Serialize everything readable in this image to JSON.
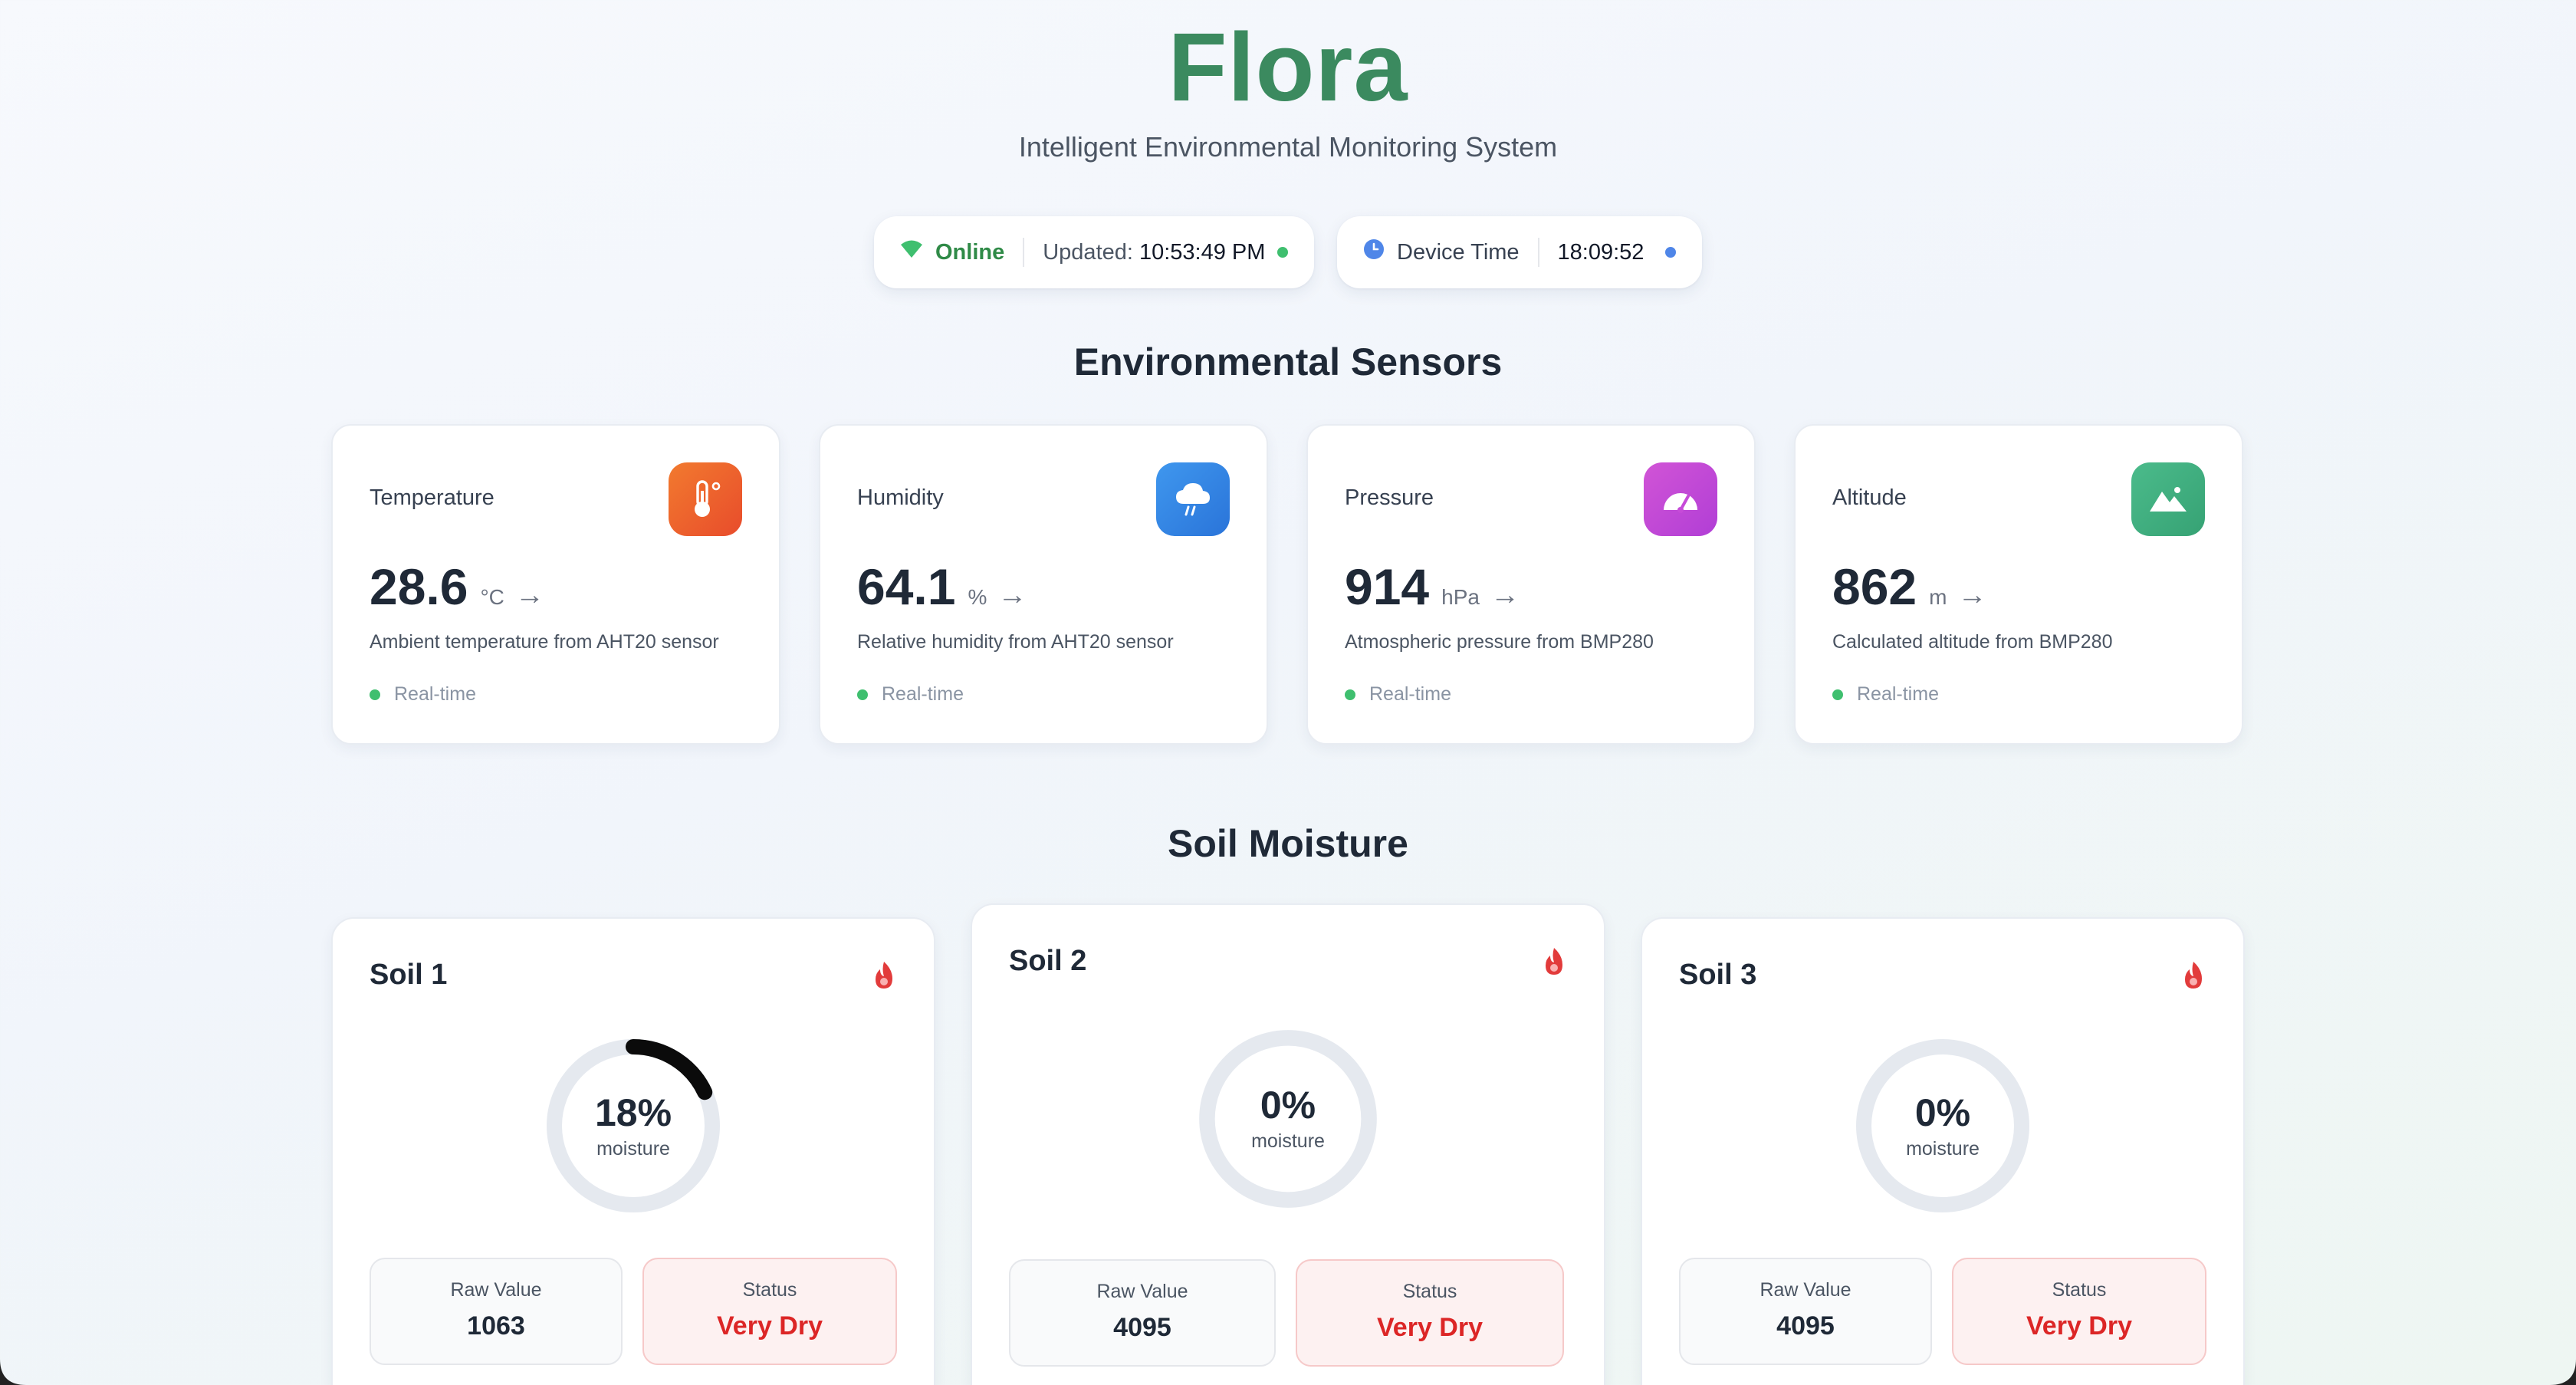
{
  "header": {
    "title": "Flora",
    "subtitle": "Intelligent Environmental Monitoring System"
  },
  "status": {
    "online_label": "Online",
    "updated_label": "Updated:",
    "updated_time": "10:53:49 PM",
    "device_label": "Device Time",
    "device_time": "18:09:52"
  },
  "sections": {
    "environmental": "Environmental Sensors",
    "soil": "Soil Moisture"
  },
  "sensors": [
    {
      "label": "Temperature",
      "value": "28.6",
      "unit": "°C",
      "trend": "→",
      "desc": "Ambient temperature from AHT20 sensor",
      "realtime": "Real-time",
      "icon": "thermometer-icon",
      "color": "#ee5a2b"
    },
    {
      "label": "Humidity",
      "value": "64.1",
      "unit": "%",
      "trend": "→",
      "desc": "Relative humidity from AHT20 sensor",
      "realtime": "Real-time",
      "icon": "cloud-rain-icon",
      "color": "#2f86e6"
    },
    {
      "label": "Pressure",
      "value": "914",
      "unit": "hPa",
      "trend": "→",
      "desc": "Atmospheric pressure from BMP280",
      "realtime": "Real-time",
      "icon": "gauge-icon",
      "color": "#c64bd8"
    },
    {
      "label": "Altitude",
      "value": "862",
      "unit": "m",
      "trend": "→",
      "desc": "Calculated altitude from BMP280",
      "realtime": "Real-time",
      "icon": "mountain-icon",
      "color": "#3fae7f"
    }
  ],
  "soil": [
    {
      "title": "Soil 1",
      "percent": "18%",
      "moisture_label": "moisture",
      "moisture_value": 18,
      "raw_label": "Raw Value",
      "raw_value": "1063",
      "status_label": "Status",
      "status_value": "Very Dry",
      "icon": "flame-icon"
    },
    {
      "title": "Soil 2",
      "percent": "0%",
      "moisture_label": "moisture",
      "moisture_value": 0,
      "raw_label": "Raw Value",
      "raw_value": "4095",
      "status_label": "Status",
      "status_value": "Very Dry",
      "icon": "flame-icon"
    },
    {
      "title": "Soil 3",
      "percent": "0%",
      "moisture_label": "moisture",
      "moisture_value": 0,
      "raw_label": "Raw Value",
      "raw_value": "4095",
      "status_label": "Status",
      "status_value": "Very Dry",
      "icon": "flame-icon"
    }
  ],
  "colors": {
    "brand": "#3b8a5f",
    "online": "#3fbf6f",
    "device_dot": "#4f86e8",
    "danger": "#dc2626"
  }
}
